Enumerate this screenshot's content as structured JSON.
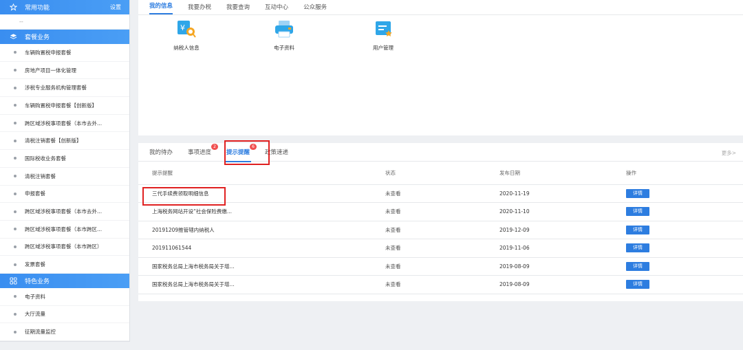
{
  "sidebar": {
    "common": {
      "title": "常用功能",
      "setting": "设置",
      "placeholder": "--"
    },
    "package": {
      "title": "套餐业务",
      "items": [
        "车辆购置税申报套餐",
        "房地产项目一体化管理",
        "涉税专业服务机构管理套餐",
        "车辆购置税申报套餐【创新版】",
        "跨区域涉税事项套餐（本市去外...",
        "清税注销套餐【创新版】",
        "国际税收业务套餐",
        "清税注销套餐",
        "申报套餐",
        "跨区域涉税事项套餐（本市去外...",
        "跨区域涉税事项套餐（本市跨区...",
        "跨区域涉税事项套餐（本市跨区）",
        "发票套餐"
      ]
    },
    "special": {
      "title": "特色业务",
      "items": [
        "电子资料",
        "大厅流量",
        "征期流量监控"
      ]
    }
  },
  "top_tabs": [
    "我的信息",
    "我要办税",
    "我要查询",
    "互动中心",
    "公众服务"
  ],
  "tiles": [
    {
      "label": "纳税人信息",
      "icon": "taxpayer-info-icon"
    },
    {
      "label": "电子资料",
      "icon": "e-document-icon"
    },
    {
      "label": "用户管理",
      "icon": "user-management-icon"
    }
  ],
  "bottom_tabs": [
    {
      "label": "我的待办",
      "badge": ""
    },
    {
      "label": "事项进度",
      "badge": "2"
    },
    {
      "label": "提示提醒",
      "badge": "6"
    },
    {
      "label": "政策速递",
      "badge": ""
    }
  ],
  "more": "更多>",
  "table": {
    "headers": [
      "提示提醒",
      "状态",
      "发布日期",
      "操作"
    ],
    "rows": [
      {
        "title": "三代手续费领取明细信息",
        "status": "未查看",
        "date": "2020-11-19",
        "action": "详情"
      },
      {
        "title": "上海税务网站开设“社会保险费缴...",
        "status": "未查看",
        "date": "2020-11-10",
        "action": "详情"
      },
      {
        "title": "20191209推管辖内纳税人",
        "status": "未查看",
        "date": "2019-12-09",
        "action": "详情"
      },
      {
        "title": "201911061544",
        "status": "未查看",
        "date": "2019-11-06",
        "action": "详情"
      },
      {
        "title": "国家税务总局上海市税务局关于增...",
        "status": "未查看",
        "date": "2019-08-09",
        "action": "详情"
      },
      {
        "title": "国家税务总局上海市税务局关于增...",
        "status": "未查看",
        "date": "2019-08-09",
        "action": "详情"
      }
    ]
  },
  "colors": {
    "accent": "#2d7de0",
    "highlight": "#e02020",
    "badge": "#f05050"
  }
}
